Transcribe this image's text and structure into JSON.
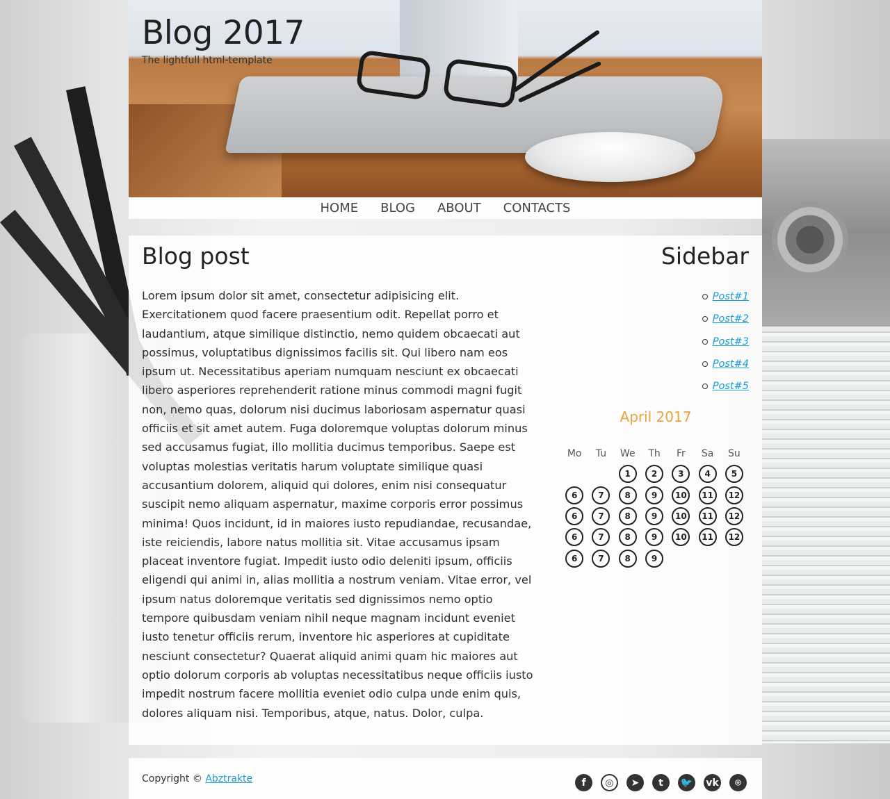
{
  "header": {
    "title": "Blog 2017",
    "tagline": "The lightfull html-template"
  },
  "nav": {
    "items": [
      {
        "label": "HOME"
      },
      {
        "label": "BLOG"
      },
      {
        "label": "ABOUT"
      },
      {
        "label": "CONTACTS"
      }
    ]
  },
  "post": {
    "title": "Blog post",
    "body": "Lorem ipsum dolor sit amet, consectetur adipisicing elit. Exercitationem quod facere praesentium odit. Repellat porro et laudantium, atque similique distinctio, nemo quidem obcaecati aut possimus, voluptatibus dignissimos facilis sit. Qui libero nam eos ipsum ut. Necessitatibus aperiam numquam nesciunt ex obcaecati libero asperiores reprehenderit ratione minus commodi magni fugit non, nemo quas, dolorum nisi ducimus laboriosam aspernatur quasi officiis et sit amet autem. Fuga doloremque voluptas dolorum minus sed accusamus fugiat, illo mollitia ducimus temporibus. Saepe est voluptas molestias veritatis harum voluptate similique quasi accusantium dolorem, aliquid qui dolores, enim nisi consequatur suscipit nemo aliquam aspernatur, maxime corporis error possimus minima! Quos incidunt, id in maiores iusto repudiandae, recusandae, iste reiciendis, labore natus mollitia sit. Vitae accusamus ipsam placeat inventore fugiat. Impedit iusto odio deleniti ipsum, officiis eligendi qui animi in, alias mollitia a nostrum veniam. Vitae error, vel ipsum natus doloremque veritatis sed dignissimos nemo optio tempore quibusdam veniam nihil neque magnam incidunt eveniet iusto tenetur officiis rerum, inventore hic asperiores at cupiditate nesciunt consectetur? Quaerat aliquid animi quam hic maiores aut optio dolorum corporis ab voluptas necessitatibus neque officiis iusto impedit nostrum facere mollitia eveniet odio culpa unde enim quis, dolores aliquam nisi. Temporibus, atque, natus. Dolor, culpa."
  },
  "sidebar": {
    "title": "Sidebar",
    "links": [
      "Post#1",
      "Post#2",
      "Post#3",
      "Post#4",
      "Post#5"
    ]
  },
  "calendar": {
    "title": "April 2017",
    "weekdays": [
      "Mo",
      "Tu",
      "We",
      "Th",
      "Fr",
      "Sa",
      "Su"
    ],
    "rows": [
      [
        "",
        "",
        "1",
        "2",
        "3",
        "4",
        "5"
      ],
      [
        "6",
        "7",
        "8",
        "9",
        "10",
        "11",
        "12"
      ],
      [
        "6",
        "7",
        "8",
        "9",
        "10",
        "11",
        "12"
      ],
      [
        "6",
        "7",
        "8",
        "9",
        "10",
        "11",
        "12"
      ],
      [
        "6",
        "7",
        "8",
        "9",
        "",
        "",
        ""
      ]
    ],
    "accent_color": "#e9a441"
  },
  "footer": {
    "copyright_prefix": "Copyright ©",
    "author_link": "Abztrakte",
    "socials": [
      {
        "name": "facebook-icon",
        "glyph": "f"
      },
      {
        "name": "instagram-icon",
        "glyph": "◎"
      },
      {
        "name": "telegram-icon",
        "glyph": "➤"
      },
      {
        "name": "tumblr-icon",
        "glyph": "t"
      },
      {
        "name": "twitter-icon",
        "glyph": "🐦"
      },
      {
        "name": "vk-icon",
        "glyph": "vk"
      },
      {
        "name": "github-icon",
        "glyph": "⌾"
      }
    ]
  },
  "colors": {
    "link": "#1a9ed6",
    "calendar_title": "#e9a441"
  }
}
